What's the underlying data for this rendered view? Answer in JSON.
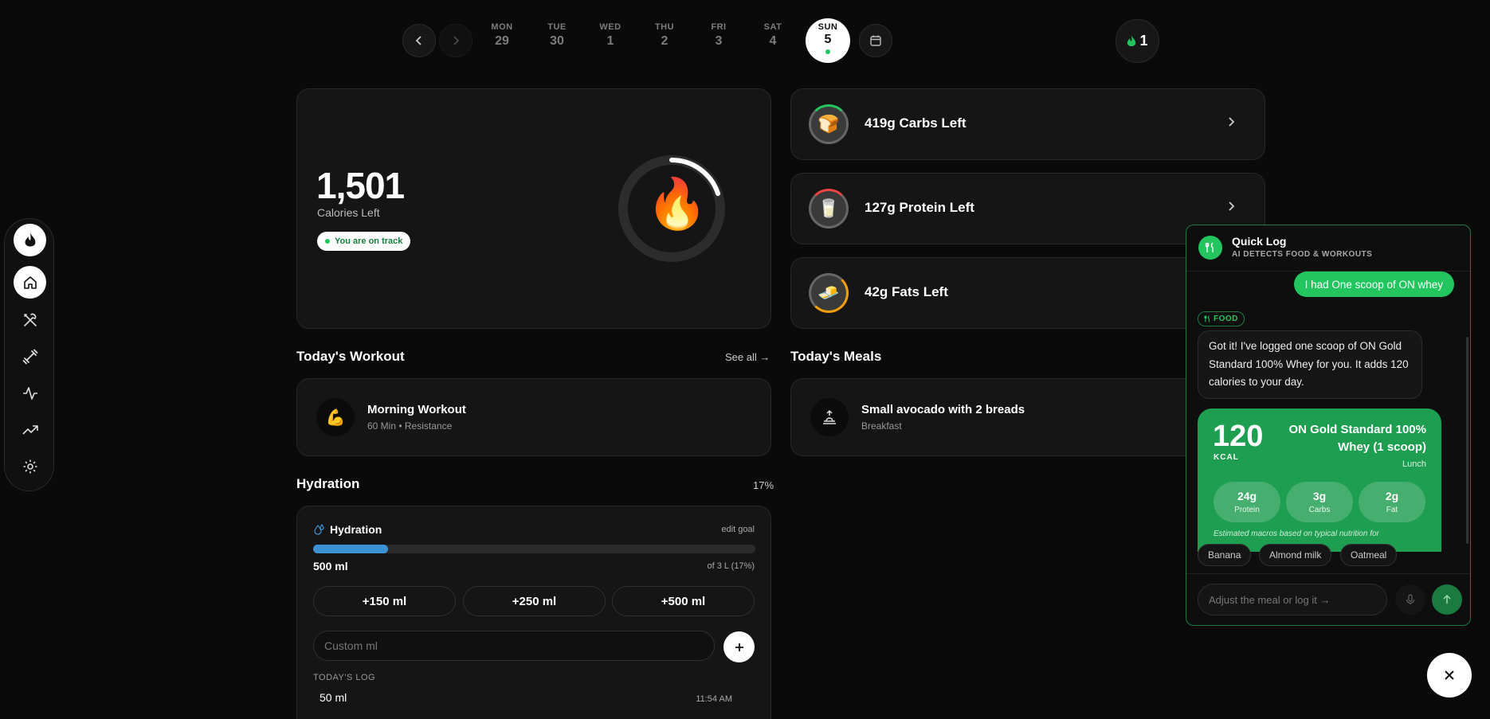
{
  "date_nav": {
    "days": [
      {
        "name": "MON",
        "num": "29"
      },
      {
        "name": "TUE",
        "num": "30"
      },
      {
        "name": "WED",
        "num": "1"
      },
      {
        "name": "THU",
        "num": "2"
      },
      {
        "name": "FRI",
        "num": "3"
      },
      {
        "name": "SAT",
        "num": "4"
      },
      {
        "name": "SUN",
        "num": "5"
      }
    ],
    "streak_count": "1"
  },
  "calories": {
    "value": "1,501",
    "label": "Calories Left",
    "status": "You are on track",
    "ring_progress": 0.2
  },
  "macros": [
    {
      "label": "419g Carbs Left",
      "icon": "🍞"
    },
    {
      "label": "127g Protein Left",
      "icon": "🥛"
    },
    {
      "label": "42g Fats Left",
      "icon": "🧈"
    }
  ],
  "workout": {
    "section_title": "Today's Workout",
    "see_all": "See all →",
    "name": "Morning Workout",
    "detail": "60 Min • Resistance",
    "icon": "💪"
  },
  "meals": {
    "section_title": "Today's Meals",
    "name": "Small avocado with 2 breads",
    "meal_type": "Breakfast"
  },
  "hydration": {
    "section_title": "Hydration",
    "percent": "17%",
    "card_title": "Hydration",
    "edit_goal": "edit goal",
    "amount": "500 ml",
    "goal_text": "of 3 L (17%)",
    "progress": 0.17,
    "buttons": [
      "+150 ml",
      "+250 ml",
      "+500 ml"
    ],
    "custom_placeholder": "Custom ml",
    "log_title": "TODAY'S LOG",
    "log": [
      {
        "amount": "50 ml",
        "time": "11:54 AM"
      }
    ]
  },
  "quick_log": {
    "title": "Quick Log",
    "subtitle": "AI DETECTS FOOD & WORKOUTS",
    "user_msg": "I had One scoop of ON whey",
    "tag": "FOOD",
    "ai_msg": "Got it! I've logged one scoop of ON Gold Standard 100% Whey for you. It adds 120 calories to your day.",
    "kcal": "120",
    "kcal_label": "KCAL",
    "food_name": "ON Gold Standard 100% Whey (1 scoop)",
    "meal": "Lunch",
    "macros": [
      {
        "value": "24g",
        "label": "Protein"
      },
      {
        "value": "3g",
        "label": "Carbs"
      },
      {
        "value": "2g",
        "label": "Fat"
      }
    ],
    "note": "Estimated macros based on typical nutrition for",
    "suggestions": [
      "Banana",
      "Almond milk",
      "Oatmeal"
    ],
    "input_placeholder": "Adjust the meal or log it →"
  },
  "colors": {
    "accent": "#22c55e",
    "water": "#3b93d6",
    "bg": "#0a0a0a"
  }
}
